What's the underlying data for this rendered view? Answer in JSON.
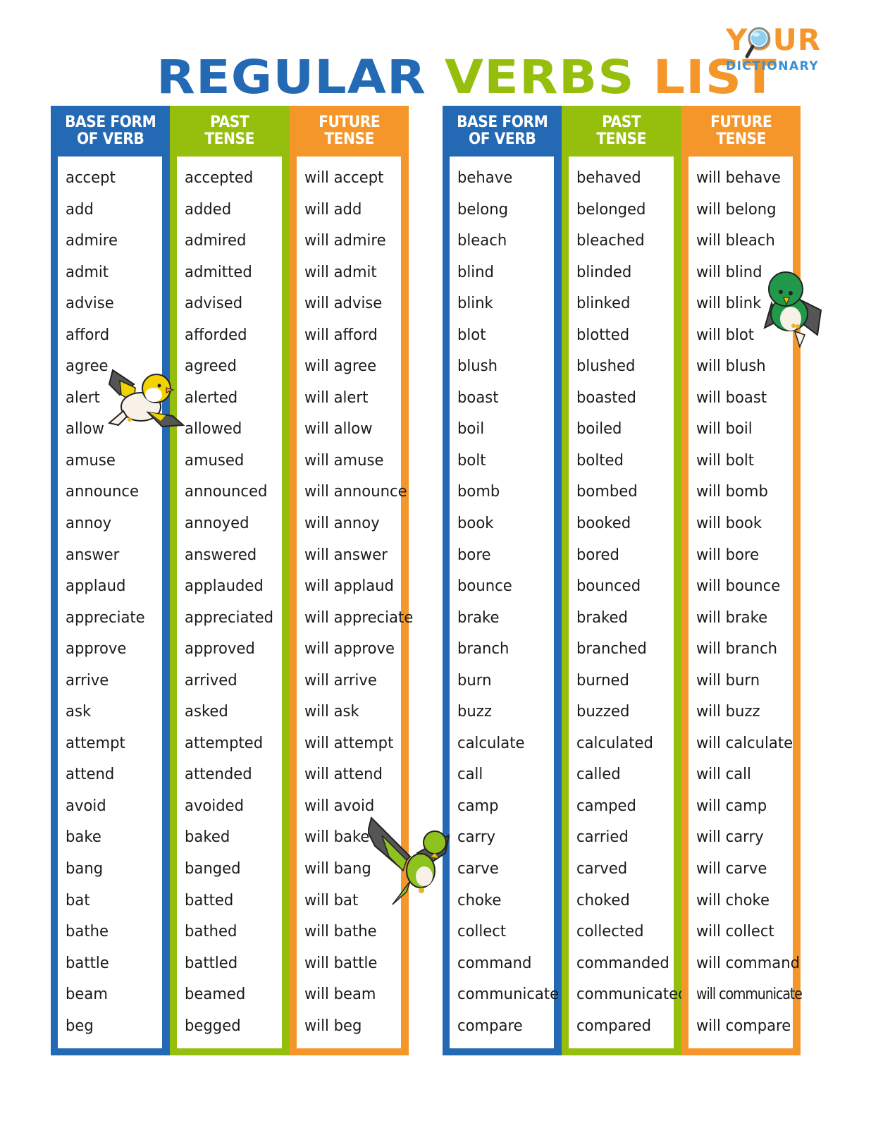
{
  "title": {
    "word1": "REGULAR",
    "word2": "VERBS",
    "word3": "LIST"
  },
  "logo": {
    "top_text": "YOUR",
    "bottom_text": "DICTIONARY",
    "icon": "magnifier-icon"
  },
  "colors": {
    "blue": "#2369b4",
    "green": "#96bf0d",
    "orange": "#f5962a"
  },
  "headers": {
    "base": [
      "BASE FORM",
      "OF VERB"
    ],
    "past": [
      "PAST",
      "TENSE"
    ],
    "future": [
      "FUTURE",
      "TENSE"
    ]
  },
  "left_table": {
    "base": [
      "accept",
      "add",
      "admire",
      "admit",
      "advise",
      "afford",
      "agree",
      "alert",
      "allow",
      "amuse",
      "announce",
      "annoy",
      "answer",
      "applaud",
      "appreciate",
      "approve",
      "arrive",
      "ask",
      "attempt",
      "attend",
      "avoid",
      "bake",
      "bang",
      "bat",
      "bathe",
      "battle",
      "beam",
      "beg"
    ],
    "past": [
      "accepted",
      "added",
      "admired",
      "admitted",
      "advised",
      "afforded",
      "agreed",
      "alerted",
      "allowed",
      "amused",
      "announced",
      "annoyed",
      "answered",
      "applauded",
      "appreciated",
      "approved",
      "arrived",
      "asked",
      "attempted",
      "attended",
      "avoided",
      "baked",
      "banged",
      "batted",
      "bathed",
      "battled",
      "beamed",
      "begged"
    ],
    "future": [
      "will accept",
      "will add",
      "will admire",
      "will admit",
      "will advise",
      "will afford",
      "will agree",
      "will alert",
      "will allow",
      "will amuse",
      "will announce",
      "will annoy",
      "will answer",
      "will applaud",
      "will appreciate",
      "will approve",
      "will arrive",
      "will ask",
      "will attempt",
      "will attend",
      "will avoid",
      "will bake",
      "will bang",
      "will bat",
      "will bathe",
      "will battle",
      "will beam",
      "will beg"
    ]
  },
  "right_table": {
    "base": [
      "behave",
      "belong",
      "bleach",
      "blind",
      "blink",
      "blot",
      "blush",
      "boast",
      "boil",
      "bolt",
      "bomb",
      "book",
      "bore",
      "bounce",
      "brake",
      "branch",
      "burn",
      "buzz",
      "calculate",
      "call",
      "camp",
      "carry",
      "carve",
      "choke",
      "collect",
      "command",
      "communicate",
      "compare"
    ],
    "past": [
      "behaved",
      "belonged",
      "bleached",
      "blinded",
      "blinked",
      "blotted",
      "blushed",
      "boasted",
      "boiled",
      "bolted",
      "bombed",
      "booked",
      "bored",
      "bounced",
      "braked",
      "branched",
      "burned",
      "buzzed",
      "calculated",
      "called",
      "camped",
      "carried",
      "carved",
      "choked",
      "collected",
      "commanded",
      "communicated",
      "compared"
    ],
    "future": [
      "will behave",
      "will belong",
      "will bleach",
      "will blind",
      "will blink",
      "will blot",
      "will blush",
      "will boast",
      "will boil",
      "will bolt",
      "will bomb",
      "will book",
      "will bore",
      "will bounce",
      "will brake",
      "will branch",
      "will burn",
      "will buzz",
      "will calculate",
      "will call",
      "will camp",
      "will carry",
      "will carve",
      "will choke",
      "will collect",
      "will command",
      "will communicate",
      "will compare"
    ]
  },
  "decorations": [
    "yellow-bird-icon",
    "green-bird-perched-icon",
    "green-bird-flying-icon"
  ]
}
